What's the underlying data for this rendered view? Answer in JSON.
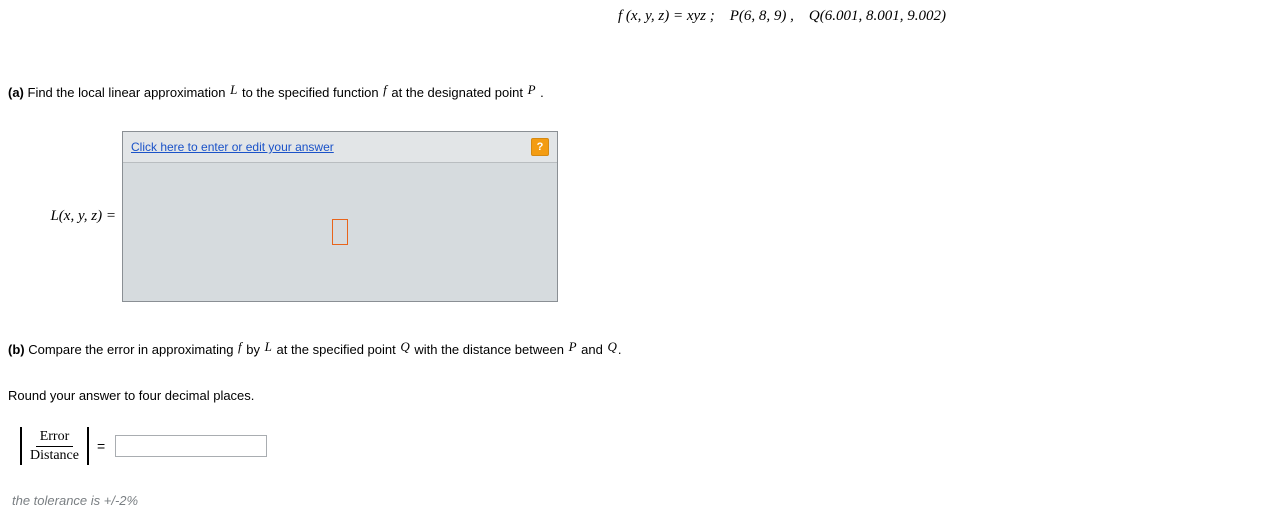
{
  "header": {
    "formula": "f (x, y, z) = xyz ; P(6, 8, 9) , Q(6.001, 8.001, 9.002)"
  },
  "partA": {
    "label": "(a)",
    "text1": " Find the local linear approximation ",
    "var1": "L",
    "text2": " to the specified function ",
    "var2": "f",
    "text3": " at the designated point ",
    "var3": "P",
    "text4": " ."
  },
  "answer": {
    "lhs": "L(x, y, z) =",
    "link": "Click here to enter or edit your answer",
    "help": "?"
  },
  "partB": {
    "label": "(b)",
    "text1": " Compare the error in approximating ",
    "var1": "f",
    "text2": " by ",
    "var2": "L",
    "text3": " at the specified point ",
    "var3": "Q",
    "text4": " with the distance between ",
    "var4": "P",
    "text5": " and ",
    "var5": "Q",
    "text6": "."
  },
  "roundNote": "Round your answer to four decimal places.",
  "ratio": {
    "numerator": "Error",
    "denominator": "Distance",
    "equals": "=",
    "value": ""
  },
  "tolerance": "the tolerance is +/-2%"
}
